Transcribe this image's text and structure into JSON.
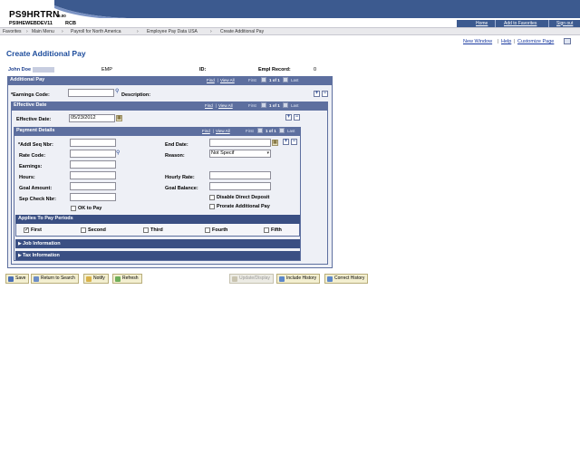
{
  "banner": {
    "system_title": "PS9HRTRN",
    "version": "9.00",
    "db_name": "PS9HEWEBDEV11",
    "db_user": "RCB",
    "links": [
      "Home",
      "Add to Favorites",
      "Sign out"
    ]
  },
  "breadcrumb": [
    "Favorites",
    "Main Menu",
    "Payroll for North America",
    "Employee Pay Data USA",
    "Create Additional Pay"
  ],
  "page_links": [
    "New Window",
    "Help",
    "Customize Page"
  ],
  "page_title": "Create Additional Pay",
  "employee": {
    "name": "John Doe",
    "emp_label": "EMP",
    "id_label": "ID:",
    "empl_record_label": "Empl Record:",
    "empl_record": "0"
  },
  "grid_nav": {
    "find": "Find",
    "view_all": "View All",
    "first": "First",
    "count": "1 of 1",
    "last": "Last"
  },
  "additional_pay": {
    "title": "Additional Pay",
    "earnings_code_label": "*Earnings Code:",
    "earnings_code_value": "",
    "description_label": "Description:"
  },
  "effective_date": {
    "title": "Effective Date",
    "label": "Effective Date:",
    "value": "05/23/2012"
  },
  "payment_details": {
    "title": "Payment Details",
    "addl_seq_label": "*Addl Seq Nbr:",
    "rate_code_label": "Rate Code:",
    "earnings_label": "Earnings:",
    "hours_label": "Hours:",
    "goal_amount_label": "Goal Amount:",
    "sep_check_label": "Sep Check Nbr:",
    "ok_to_pay_label": "OK to Pay",
    "end_date_label": "End Date:",
    "reason_label": "Reason:",
    "reason_value": "Not Specif",
    "hourly_rate_label": "Hourly Rate:",
    "goal_balance_label": "Goal Balance:",
    "disable_dd_label": "Disable Direct Deposit",
    "prorate_label": "Prorate Additional Pay"
  },
  "applies_to": {
    "title": "Applies To Pay Periods",
    "periods": [
      {
        "label": "First",
        "checked": true
      },
      {
        "label": "Second",
        "checked": false
      },
      {
        "label": "Third",
        "checked": false
      },
      {
        "label": "Fourth",
        "checked": false
      },
      {
        "label": "Fifth",
        "checked": false
      }
    ]
  },
  "sections": {
    "job_info": "Job Information",
    "tax_info": "Tax Information"
  },
  "toolbar": {
    "save": "Save",
    "return_to_search": "Return to Search",
    "notify": "Notify",
    "refresh": "Refresh",
    "update_display": "Update/Display",
    "include_history": "Include History",
    "correct_history": "Correct History"
  },
  "colors": {
    "header_blue": "#5d6f9f",
    "title_blue": "#1d4c9c",
    "panel_bg": "#eef0f6"
  }
}
